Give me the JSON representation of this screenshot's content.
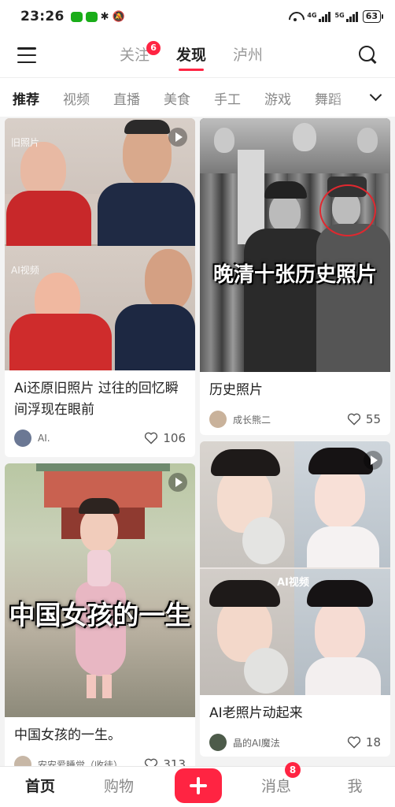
{
  "status_bar": {
    "time": "23:26",
    "battery": "63",
    "network_label_1": "4G",
    "network_label_2": "5G"
  },
  "top_nav": {
    "tabs": [
      {
        "label": "关注",
        "badge": "6"
      },
      {
        "label": "发现",
        "active": true
      },
      {
        "label": "泸州"
      }
    ]
  },
  "categories": [
    "推荐",
    "视频",
    "直播",
    "美食",
    "手工",
    "游戏",
    "舞蹈"
  ],
  "feed": {
    "left": [
      {
        "tag_top": "旧照片",
        "tag_bottom": "AI视频",
        "title": "Ai还原旧照片 过往的回忆瞬间浮现在眼前",
        "author": "AI.",
        "likes": "106"
      },
      {
        "overlay": "中国女孩的一生",
        "title": "中国女孩的一生。",
        "author": "安安爱睡觉（收徒）",
        "likes": "313"
      }
    ],
    "right": [
      {
        "overlay": "晚清十张历史照片",
        "title": "历史照片",
        "author": "成长熊二",
        "likes": "55"
      },
      {
        "tag": "AI视频",
        "title": "AI老照片动起来",
        "author": "晶的AI魔法",
        "likes": "18"
      }
    ]
  },
  "bottom_bar": {
    "home": "首页",
    "shop": "购物",
    "messages": "消息",
    "messages_badge": "8",
    "me": "我"
  },
  "colors": {
    "accent": "#ff2442",
    "background": "#f3f3f3"
  }
}
